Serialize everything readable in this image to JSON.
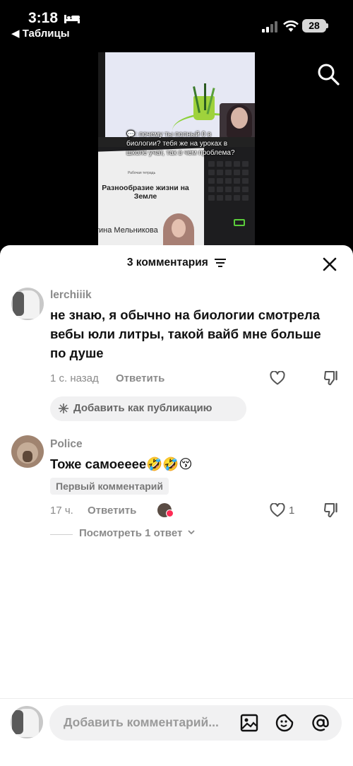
{
  "status_bar": {
    "time": "3:18",
    "battery": "28",
    "back_app": "◀ Таблицы"
  },
  "video": {
    "caption": ": почему ты полный 0 в биологии? тебя же на уроках в школе учат, так в чем проблема?",
    "caption_icon": "speech-bubble-icon",
    "paper_label": "Рабочая тетрадь",
    "paper_title": "Разнообразие жизни на Земле",
    "paper_name": "тина Мельникова"
  },
  "sheet": {
    "title": "3 комментария",
    "comments": [
      {
        "username": "lerchiiik",
        "text": "не знаю, я обычно на биологии смотрела вебы юли литры, такой вайб мне больше по душе",
        "time": "1 с. назад",
        "reply_label": "Ответить",
        "add_as_post": "Добавить как публикацию"
      },
      {
        "username": "Police",
        "text": "Тоже самоееее🤣🤣😚",
        "badge": "Первый комментарий",
        "time": "17 ч.",
        "reply_label": "Ответить",
        "likes": "1",
        "view_replies": "Посмотреть 1 ответ"
      }
    ]
  },
  "input": {
    "placeholder": "Добавить комментарий..."
  },
  "colors": {
    "accent_heart": "#fe2c55",
    "muted_text": "#8a8a8a",
    "pill_bg": "#f1f1f2"
  }
}
